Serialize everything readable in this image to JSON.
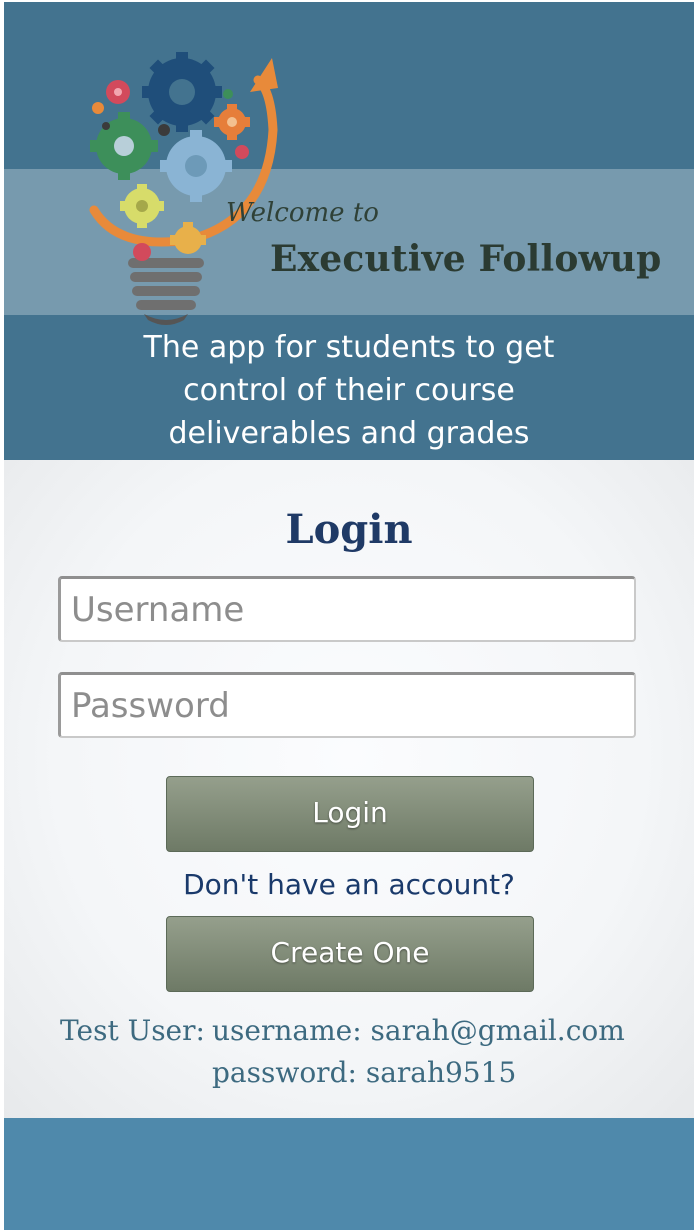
{
  "header": {
    "welcome": "Welcome to",
    "app_name": "Executive Followup",
    "tagline": [
      "The app for students to get",
      "control of their course",
      "deliverables and grades"
    ]
  },
  "login": {
    "title": "Login",
    "username_placeholder": "Username",
    "password_placeholder": "Password",
    "login_button": "Login",
    "no_account_text": "Don't have an account?",
    "create_button": "Create One"
  },
  "test_user": {
    "label": "Test User:",
    "username_line": "username: sarah@gmail.com",
    "password_line": "password: sarah9515"
  },
  "colors": {
    "header_bg": "#43738f",
    "footer_bg": "#4f89ab",
    "title_color": "#1f3a66",
    "button_color": "#7b8772",
    "app_name_color": "#2b3b32"
  },
  "logo": {
    "icon": "lightbulb-gears-logo"
  }
}
